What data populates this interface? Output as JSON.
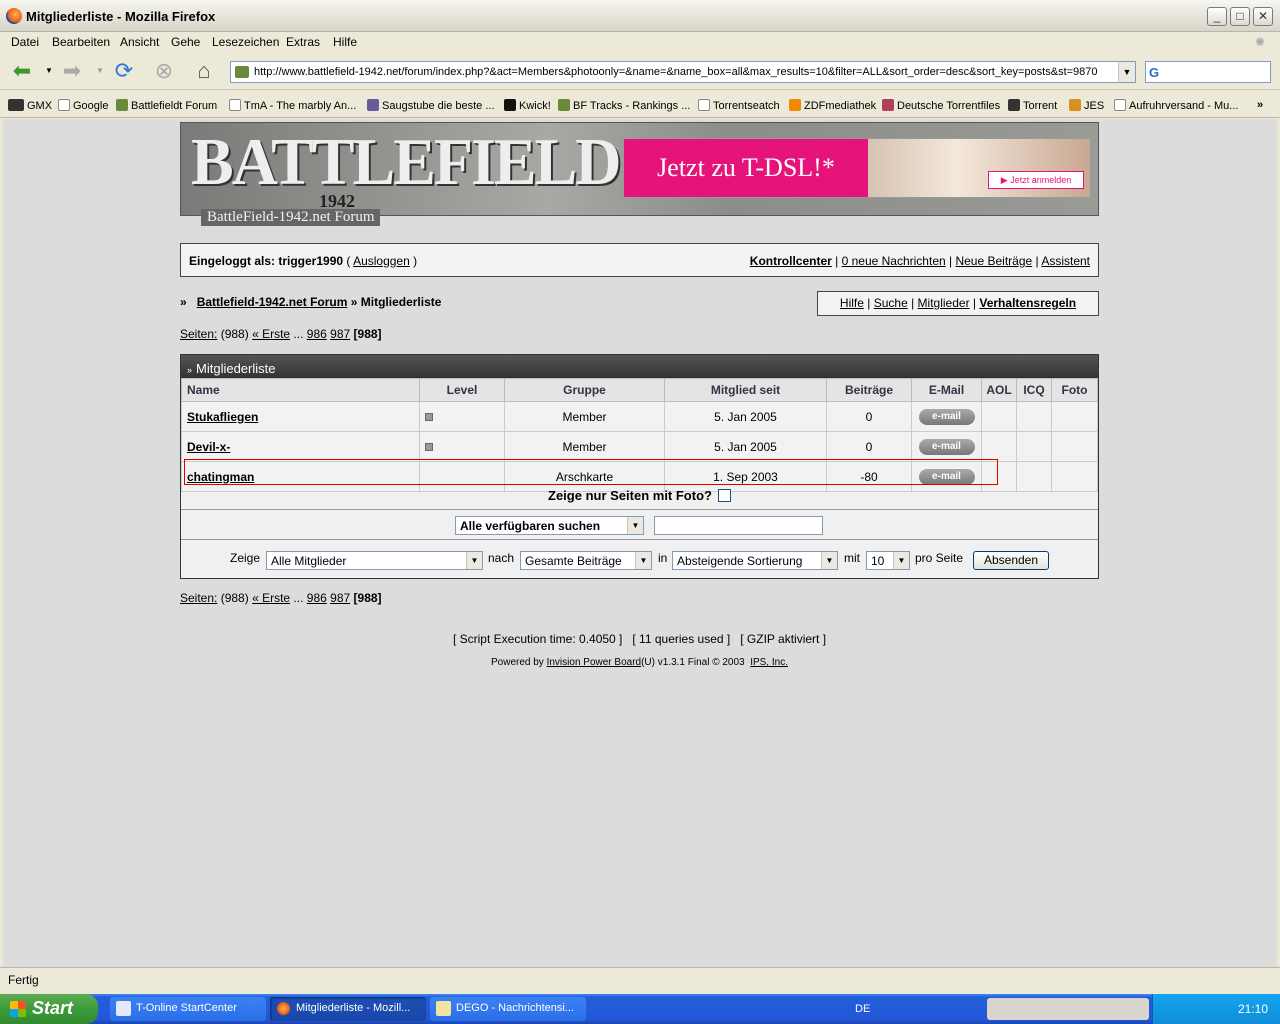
{
  "window": {
    "title": "Mitgliederliste - Mozilla Firefox"
  },
  "menu": [
    "Datei",
    "Bearbeiten",
    "Ansicht",
    "Gehe",
    "Lesezeichen",
    "Extras",
    "Hilfe"
  ],
  "address": {
    "url": "http://www.battlefield-1942.net/forum/index.php?&act=Members&photoonly=&name=&name_box=all&max_results=10&filter=ALL&sort_order=desc&sort_key=posts&st=9870"
  },
  "bookmarks": [
    "GMX",
    "Google",
    "Battlefieldt Forum",
    "TmA - The marbly An...",
    "Saugstube die beste ...",
    "Kwick!",
    "BF Tracks - Rankings ...",
    "Torrentseatch",
    "ZDFmediathek",
    "Deutsche Torrentfiles",
    "Torrent",
    "JES",
    "Aufruhrversand - Mu..."
  ],
  "banner": {
    "logo": "BATTLEFIELD",
    "year": "1942",
    "subtitle": "BattleField-1942.net Forum",
    "ad_text": "Jetzt zu T-DSL!*",
    "ad_button": "Jetzt anmelden"
  },
  "userbar": {
    "logged_in": "Eingeloggt als: trigger1990",
    "logout": "Ausloggen",
    "links": [
      "Kontrollcenter",
      "0 neue Nachrichten",
      "Neue Beiträge",
      "Assistent"
    ]
  },
  "breadcrumb": {
    "root": "Battlefield-1942.net Forum",
    "current": "Mitgliederliste"
  },
  "helplinks": [
    "Hilfe",
    "Suche",
    "Mitglieder",
    "Verhaltensregeln"
  ],
  "pagination": {
    "label": "Seiten:",
    "count": "(988)",
    "first": "« Erste",
    "ellipsis": "...",
    "p1": "986",
    "p2": "987",
    "current": "[988]"
  },
  "members_table": {
    "title": "Mitgliederliste",
    "columns": [
      "Name",
      "Level",
      "Gruppe",
      "Mitglied seit",
      "Beiträge",
      "E-Mail",
      "AOL",
      "ICQ",
      "Foto"
    ],
    "rows": [
      {
        "name": "Stukafliegen",
        "group": "Member",
        "since": "5. Jan 2005",
        "posts": "0",
        "email": "e-mail"
      },
      {
        "name": "Devil-x-",
        "group": "Member",
        "since": "5. Jan 2005",
        "posts": "0",
        "email": "e-mail"
      },
      {
        "name": "chatingman",
        "group": "Arschkarte",
        "since": "1. Sep 2003",
        "posts": "-80",
        "email": "e-mail"
      }
    ]
  },
  "photo_filter": "Zeige nur Seiten mit Foto?",
  "search": {
    "scope": "Alle verfügbaren suchen"
  },
  "filter": {
    "show_label": "Zeige",
    "show_value": "Alle Mitglieder",
    "by_label": "nach",
    "by_value": "Gesamte Beiträge",
    "in_label": "in",
    "order_value": "Absteigende Sortierung",
    "with_label": "mit",
    "count_value": "10",
    "per_page": "pro Seite",
    "submit": "Absenden"
  },
  "footer": {
    "exec": "[ Script Execution time: 0.4050 ]   [ 11 queries used ]   [ GZIP aktiviert ]",
    "powered_pre": "Powered by",
    "powered_link": "Invision Power Board",
    "powered_post": "(U) v1.3.1 Final © 2003",
    "ips": "IPS, Inc."
  },
  "status": "Fertig",
  "taskbar": {
    "start": "Start",
    "tasks": [
      "T-Online StartCenter",
      "Mitgliederliste - Mozill...",
      "DEGO - Nachrichtensi..."
    ],
    "lang": "DE",
    "clock": "21:10"
  }
}
